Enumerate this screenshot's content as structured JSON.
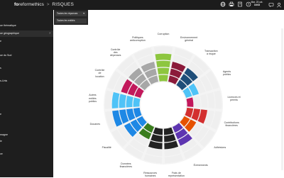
{
  "topbar": {
    "brand_bold": "fo",
    "brand_reg": "reformethics",
    "separator": ">",
    "section": "RISQUES",
    "icons": [
      "globe-icon",
      "print-icon",
      "book-icon",
      "help-icon"
    ],
    "date": "Mar. 23 oct.",
    "time": "16:03",
    "right_icons": [
      "chat-icon",
      "user-icon"
    ]
  },
  "sidebar": {
    "items": [
      {
        "label": "ue thématique",
        "active": false
      },
      {
        "label": "ue géographique",
        "active": true
      },
      {
        "label": "e",
        "active": false
      },
      {
        "label": "",
        "active": false
      },
      {
        "label": "ue du Sud",
        "active": false
      },
      {
        "label": "",
        "active": false
      },
      {
        "label": "s",
        "active": false
      },
      {
        "label": "",
        "active": false
      },
      {
        "label": "s-Unis",
        "active": false
      },
      {
        "label": "",
        "active": false
      },
      {
        "label": "",
        "active": false
      },
      {
        "label": "",
        "active": false
      },
      {
        "label": "",
        "active": false
      },
      {
        "label": "e",
        "active": false
      },
      {
        "label": "",
        "active": false
      },
      {
        "label": "",
        "active": false
      },
      {
        "label": "magne",
        "active": false
      },
      {
        "label": "ie",
        "active": false
      },
      {
        "label": "",
        "active": false
      },
      {
        "label": "ce",
        "active": false
      }
    ]
  },
  "filters": {
    "all_responses": "Toutes les réponses",
    "all_entities": "Toutes les entités"
  },
  "chart": {
    "labels": [
      "Corruption",
      "Environnement\ngénéral",
      "Transaction\nà risque",
      "Agents\npublics",
      "Licences et\npermis",
      "Contributions\nfinancières",
      "Adhésions",
      "Évènements",
      "Frais de\nreprésentation",
      "Ressources\nhumaines",
      "Données\nfinancières",
      "Fiscalité",
      "Douanes",
      "Autres\nentités\npublics",
      "Contrôle\nde\nlocation",
      "Contrôle\ndes\ndépenses",
      "Politiques\nanticorruption"
    ],
    "colors": {
      "green": "#8dc63f",
      "grey": "#a7a7a7",
      "maroon": "#8b1a3a",
      "crimson": "#c2185b",
      "navy": "#1f4e79",
      "cyan": "#4fc3f7",
      "red": "#d32f2f",
      "orange": "#e65100",
      "purple": "#5e35b1",
      "black": "#222222",
      "olive": "#3a7d1e",
      "blue": "#1e88e5",
      "empty": "#efefef"
    }
  }
}
